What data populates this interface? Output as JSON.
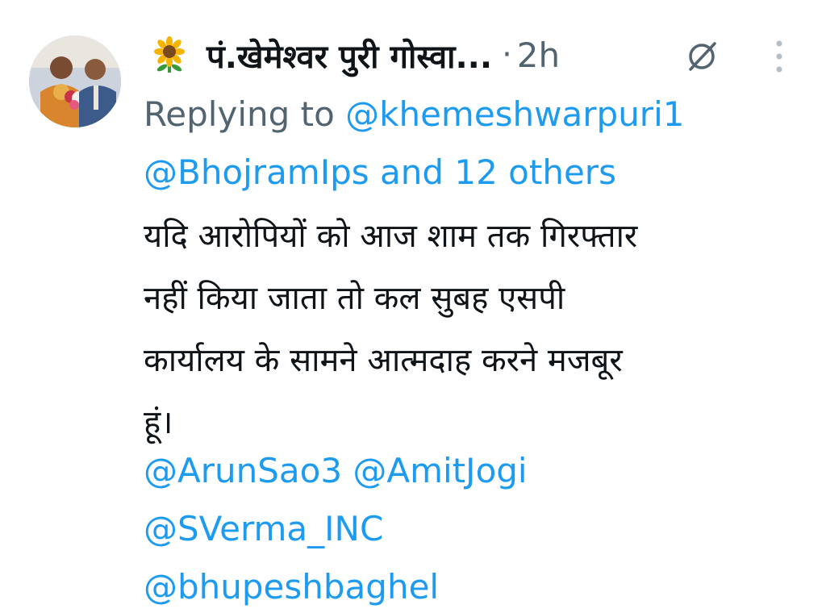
{
  "author": {
    "name": "पं.खेमेश्वर पुरी गोस्वा...",
    "emoji_icon": "sunflower-icon",
    "avatar": "profile-photo-avatar"
  },
  "meta": {
    "separator": "·",
    "time": "2h"
  },
  "reply": {
    "prefix": "Replying to ",
    "first_handle": "@khemeshwarpuri1",
    "second_handle": "@BhojramIps",
    "suffix": "and 12 others"
  },
  "body": {
    "lines": [
      "यदि आरोपियों को आज शाम तक गिरफ्तार",
      "नहीं किया जाता तो कल सुबह एसपी",
      "कार्यालय के सामने आत्मदाह करने मजबूर",
      "हूं।"
    ]
  },
  "tags": {
    "line1": "@ArunSao3 @AmitJogi",
    "line2": "@SVerma_INC",
    "line3": "@bhupeshbaghel"
  },
  "colors": {
    "link": "#1d9bf0",
    "secondary": "#536471",
    "text": "#0f1419"
  },
  "icons": {
    "grok": "grok-slash-icon",
    "more": "more-vertical-icon"
  }
}
